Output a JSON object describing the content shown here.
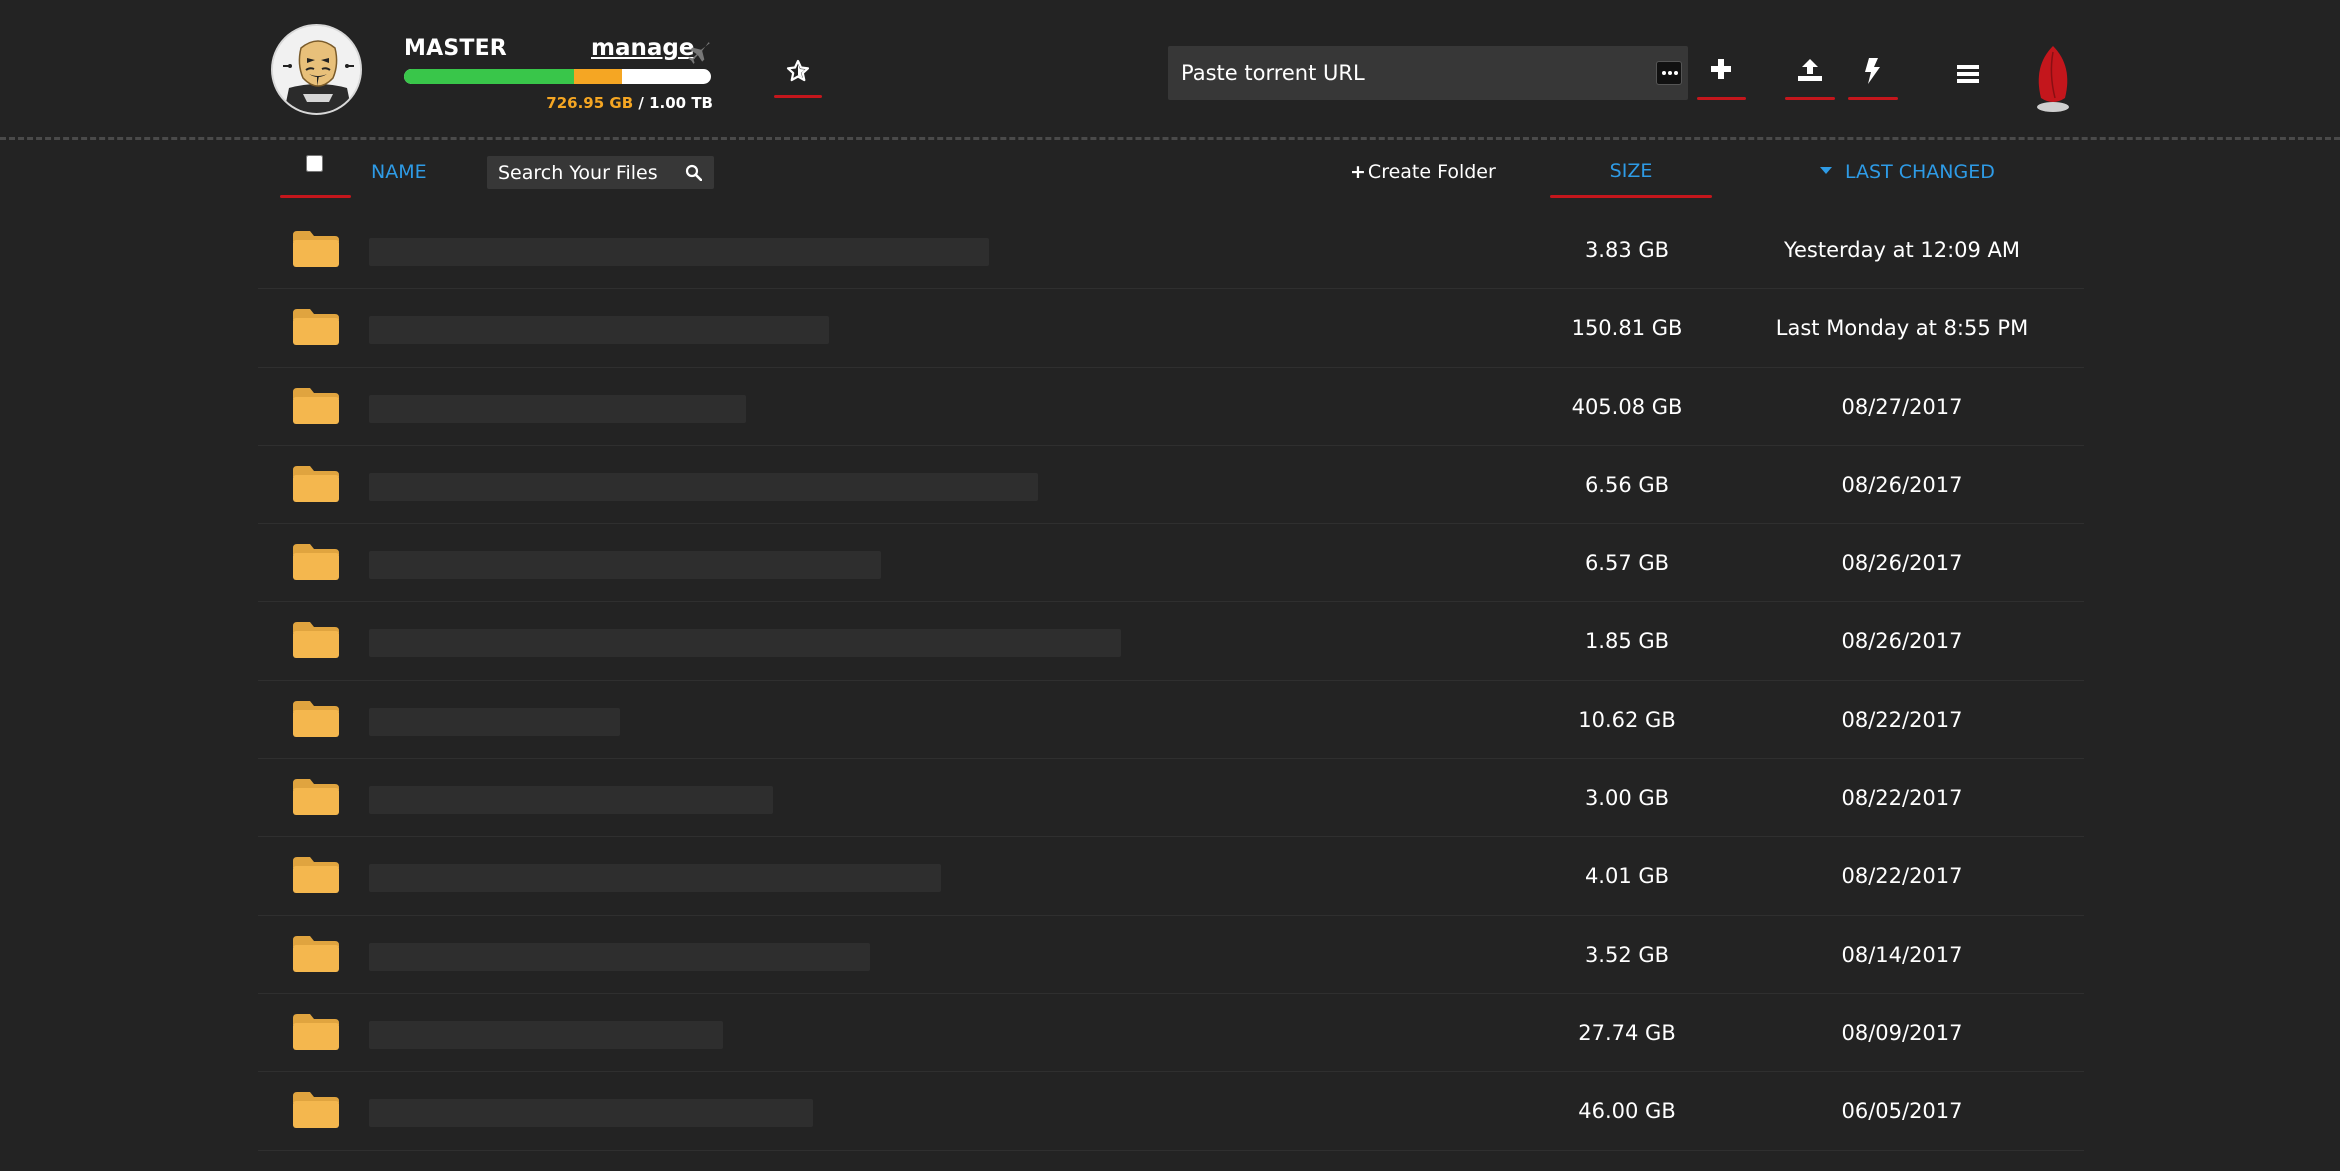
{
  "header": {
    "account_name": "MASTER",
    "manage_label": "manage",
    "quota": {
      "used": "726.95 GB",
      "separator": "/",
      "total": "1.00 TB",
      "used_fraction": 0.71,
      "green_fraction": 0.553,
      "colors": {
        "green": "#39c64a",
        "orange": "#f5a623",
        "remaining": "#ffffff"
      }
    },
    "icons": {
      "plane": "plane-icon",
      "favorites": "star-icon",
      "add": "plus-icon",
      "upload": "upload-icon",
      "bolt": "bolt-icon",
      "menu": "hamburger-menu-icon",
      "logo": "red-leaf-logo"
    },
    "torrent_input": {
      "placeholder": "Paste torrent URL",
      "value": ""
    },
    "accent_color": "#c4161c"
  },
  "list_header": {
    "name_label": "NAME",
    "search_placeholder": "Search Your Files",
    "create_folder_label": "Create Folder",
    "create_folder_icon": "+",
    "size_label": "SIZE",
    "last_changed_label": "LAST CHANGED",
    "sort_direction": "descending",
    "link_color": "#2e9be6"
  },
  "files": [
    {
      "type": "folder",
      "size": "3.83 GB",
      "changed": "Yesterday at 12:09 AM"
    },
    {
      "type": "folder",
      "size": "150.81 GB",
      "changed": "Last Monday at 8:55 PM"
    },
    {
      "type": "folder",
      "size": "405.08 GB",
      "changed": "08/27/2017"
    },
    {
      "type": "folder",
      "size": "6.56 GB",
      "changed": "08/26/2017"
    },
    {
      "type": "folder",
      "size": "6.57 GB",
      "changed": "08/26/2017"
    },
    {
      "type": "folder",
      "size": "1.85 GB",
      "changed": "08/26/2017"
    },
    {
      "type": "folder",
      "size": "10.62 GB",
      "changed": "08/22/2017"
    },
    {
      "type": "folder",
      "size": "3.00 GB",
      "changed": "08/22/2017"
    },
    {
      "type": "folder",
      "size": "4.01 GB",
      "changed": "08/22/2017"
    },
    {
      "type": "folder",
      "size": "3.52 GB",
      "changed": "08/14/2017"
    },
    {
      "type": "folder",
      "size": "27.74 GB",
      "changed": "08/09/2017"
    },
    {
      "type": "folder",
      "size": "46.00 GB",
      "changed": "06/05/2017"
    }
  ],
  "colors": {
    "background": "#232323",
    "folder": "#f4b74e",
    "redacted_name": "#2e2e2e"
  }
}
